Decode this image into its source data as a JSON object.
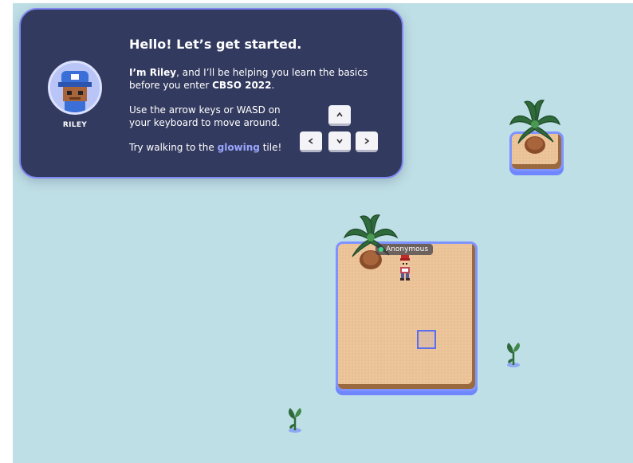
{
  "onboarding": {
    "title": "Hello! Let’s get started.",
    "guide_name": "RILEY",
    "intro_prefix": "I’m Riley",
    "intro_middle": ", and I’ll be helping you learn the basics before you enter ",
    "space_name": "CBSO 2022",
    "intro_suffix": ".",
    "movement_hint": "Use the arrow keys or WASD on your keyboard to move around.",
    "goal_prefix": "Try walking to the ",
    "goal_highlight": "glowing",
    "goal_suffix": " tile!",
    "keys": [
      "up",
      "left",
      "down",
      "right"
    ]
  },
  "player": {
    "name": "Anonymous",
    "status_color": "#40d98a"
  },
  "colors": {
    "water": "#bfdfe6",
    "card_bg": "#333a5f",
    "card_border": "#7f88f2",
    "highlight_text": "#9aa6ff",
    "sand": "#ecc59a",
    "glow": "#7f93ff"
  },
  "map_objects": [
    {
      "type": "palm-tree-island",
      "icon": "palm-tree-icon"
    },
    {
      "type": "main-island",
      "icon": "palm-tree-icon"
    },
    {
      "type": "glowing-tile"
    },
    {
      "type": "sprout",
      "icon": "sprout-icon"
    },
    {
      "type": "sprout",
      "icon": "sprout-icon"
    }
  ]
}
